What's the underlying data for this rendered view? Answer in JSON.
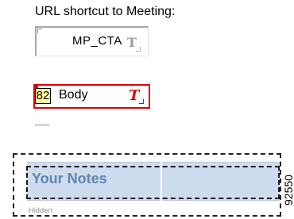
{
  "url_shortcut": {
    "label": "URL shortcut to Meeting:",
    "value": "MP_CTA",
    "icon": "text-field-icon"
  },
  "body_field": {
    "index": "82",
    "value": "Body",
    "icon": "text-field-red-icon",
    "accent_color": "#e10000"
  },
  "notes": {
    "title": "Your Notes",
    "hidden_caption": "Hidden",
    "bar_color": "#cfdcef",
    "title_color": "#5f86b0"
  },
  "figure_number": "92550"
}
